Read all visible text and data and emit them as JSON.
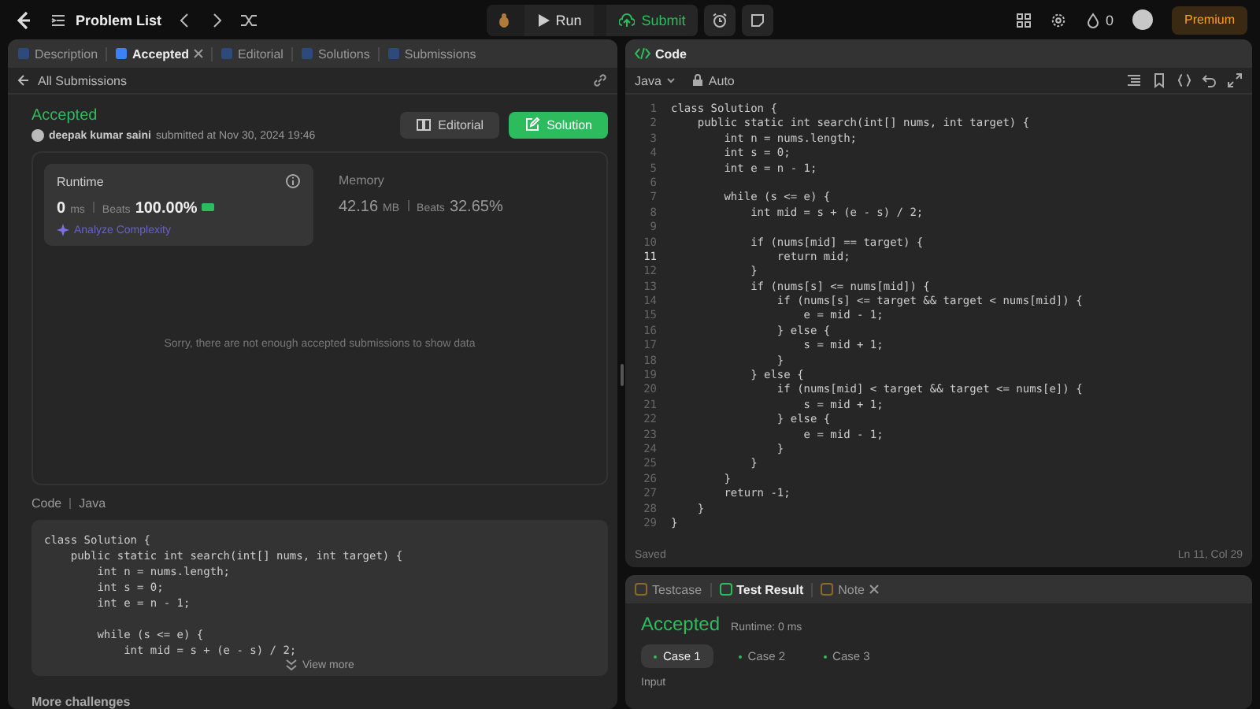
{
  "topbar": {
    "problem_list": "Problem List",
    "run": "Run",
    "submit": "Submit",
    "streak": "0",
    "premium": "Premium"
  },
  "left_tabs": [
    {
      "label": "Description",
      "selected": false,
      "closable": false
    },
    {
      "label": "Accepted",
      "selected": true,
      "closable": true
    },
    {
      "label": "Editorial",
      "selected": false,
      "closable": false
    },
    {
      "label": "Solutions",
      "selected": false,
      "closable": false
    },
    {
      "label": "Submissions",
      "selected": false,
      "closable": false
    }
  ],
  "back_link": "All Submissions",
  "submission": {
    "status": "Accepted",
    "user": "deepak kumar saini",
    "submitted": "submitted at Nov 30, 2024 19:46",
    "editorial_button": "Editorial",
    "solution_button": "Solution"
  },
  "stats": [
    {
      "title": "Runtime",
      "value": "0",
      "unit": "ms",
      "beats": "Beats",
      "percent": "100.00%",
      "selected": true,
      "link": "Analyze Complexity"
    },
    {
      "title": "Memory",
      "value": "42.16",
      "unit": "MB",
      "beats": "Beats",
      "percent": "32.65%",
      "selected": false
    }
  ],
  "empty_message": "Sorry, there are not enough accepted submissions to show data",
  "code_preview": {
    "label": "Code",
    "language": "Java",
    "view_more": "View more",
    "blocks": [
      [
        "class Solution {",
        "    public static int search(int[] nums, int target) {",
        "        int n = nums.length;",
        "        int s = 0;",
        "        int e = n - 1;"
      ],
      [
        "        while (s <= e) {",
        "            int mid = s + (e - s) / 2;"
      ]
    ]
  },
  "more_challenges": "More challenges",
  "editor": {
    "title": "Code",
    "language": "Java",
    "mode": "Auto",
    "status": "Saved",
    "cursor": "Ln 11, Col 29",
    "lines": [
      {
        "no": "1",
        "code": "class Solution {",
        "selected": false
      },
      {
        "no": "2",
        "code": "    public static int search(int[] nums, int target) {",
        "selected": false
      },
      {
        "no": "3",
        "code": "        int n = nums.length;",
        "selected": false
      },
      {
        "no": "4",
        "code": "        int s = 0;",
        "selected": false
      },
      {
        "no": "5",
        "code": "        int e = n - 1;",
        "selected": false
      },
      {
        "no": "6",
        "selected": false
      },
      {
        "no": "7",
        "code": "        while (s <= e) {",
        "selected": false
      },
      {
        "no": "8",
        "code": "            int mid = s + (e - s) / 2;",
        "selected": false
      },
      {
        "no": "9",
        "selected": false
      },
      {
        "no": "10",
        "code": "            if (nums[mid] == target) {",
        "selected": false
      },
      {
        "no": "11",
        "code": "                return mid;",
        "selected": true
      },
      {
        "no": "12",
        "code": "            }",
        "selected": false
      },
      {
        "no": "13",
        "code": "            if (nums[s] <= nums[mid]) {",
        "selected": false
      },
      {
        "no": "14",
        "code": "                if (nums[s] <= target && target < nums[mid]) {",
        "selected": false
      },
      {
        "no": "15",
        "code": "                    e = mid - 1;",
        "selected": false
      },
      {
        "no": "16",
        "code": "                } else {",
        "selected": false
      },
      {
        "no": "17",
        "code": "                    s = mid + 1;",
        "selected": false
      },
      {
        "no": "18",
        "code": "                }",
        "selected": false
      },
      {
        "no": "19",
        "code": "            } else {",
        "selected": false
      },
      {
        "no": "20",
        "code": "                if (nums[mid] < target && target <= nums[e]) {",
        "selected": false
      },
      {
        "no": "21",
        "code": "                    s = mid + 1;",
        "selected": false
      },
      {
        "no": "22",
        "code": "                } else {",
        "selected": false
      },
      {
        "no": "23",
        "code": "                    e = mid - 1;",
        "selected": false
      },
      {
        "no": "24",
        "code": "                }",
        "selected": false
      },
      {
        "no": "25",
        "code": "            }",
        "selected": false
      },
      {
        "no": "26",
        "code": "        }",
        "selected": false
      },
      {
        "no": "27",
        "code": "        return -1;",
        "selected": false
      },
      {
        "no": "28",
        "code": "    }",
        "selected": false
      },
      {
        "no": "29",
        "code": "}",
        "selected": false
      }
    ]
  },
  "bottom_tabs": [
    {
      "label": "Testcase",
      "selected": false,
      "closable": false
    },
    {
      "label": "Test Result",
      "selected": true,
      "closable": false
    },
    {
      "label": "Note",
      "selected": false,
      "closable": true
    }
  ],
  "result": {
    "status": "Accepted",
    "runtime": "Runtime: 0 ms",
    "input_label": "Input",
    "cases": [
      {
        "label": "Case 1",
        "selected": true
      },
      {
        "label": "Case 2",
        "selected": false
      },
      {
        "label": "Case 3",
        "selected": false
      }
    ]
  }
}
